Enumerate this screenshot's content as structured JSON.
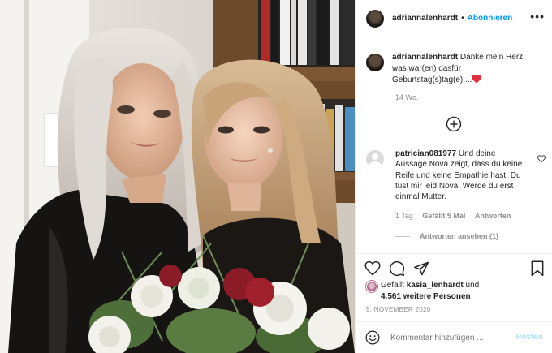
{
  "post": {
    "username": "adriannalenhardt",
    "dot": "•",
    "follow_label": "Abonnieren",
    "more_icon": "more-options-icon",
    "caption_user": "adriannalenhardt",
    "caption_text": "Danke mein Herz, was war(en) dasfür Geburtstag(s)tag(e)....",
    "caption_emoji": "red-heart-icon",
    "time_ago": "14 Wo."
  },
  "comment": {
    "user": "patrician081977",
    "text": "Und deine Aussage Nova zeigt, dass du keine Reife und keine Empathie hast. Du tust mir leid Nova. Werde du erst einmal Mutter.",
    "time": "1 Tag",
    "likes": "Gefällt 5 Mal",
    "reply": "Antworten",
    "view_replies": "Antworten ansehen (1)"
  },
  "actions": {
    "like_icon": "heart-icon",
    "comment_icon": "comment-icon",
    "share_icon": "share-icon",
    "save_icon": "bookmark-icon"
  },
  "likes": {
    "prefix": "Gefällt",
    "user": "kasia_lenhardt",
    "conj": "und",
    "count": "4.561 weitere Personen"
  },
  "date": "9. NOVEMBER 2020",
  "composer": {
    "placeholder": "Kommentar hinzufügen ...",
    "post_label": "Posten",
    "emoji_icon": "smiley-icon"
  },
  "colors": {
    "link_blue": "#0095f6",
    "post_disabled": "#b2dffc",
    "secondary_text": "#8e8e8e"
  }
}
